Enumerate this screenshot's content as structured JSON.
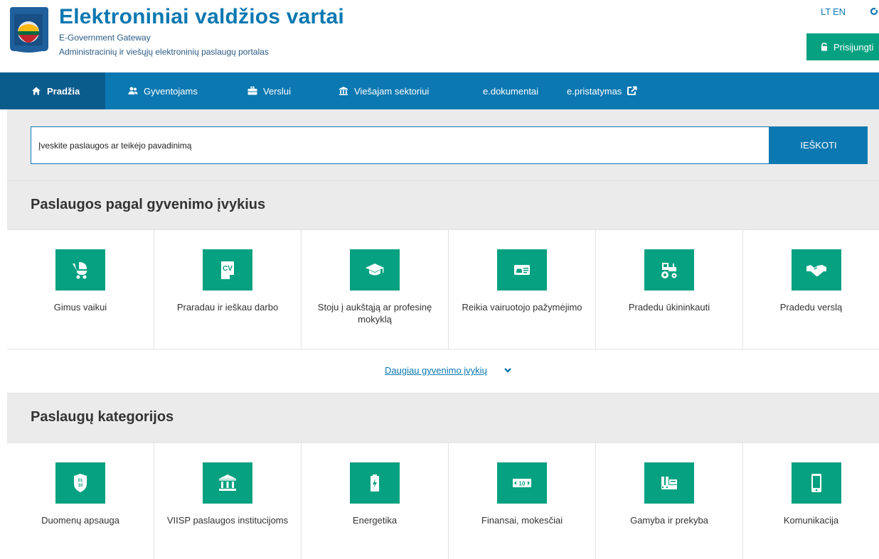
{
  "header": {
    "title": "Elektroniniai valdžios vartai",
    "subtitle": "E-Government Gateway",
    "tagline": "Administracinių ir viešųjų elektroninių paslaugų portalas",
    "lang_lt": "LT",
    "lang_en": "EN",
    "login_label": "Prisijungti"
  },
  "nav": {
    "items": [
      {
        "label": "Pradžia",
        "icon": "home-icon"
      },
      {
        "label": "Gyventojams",
        "icon": "users-icon"
      },
      {
        "label": "Verslui",
        "icon": "briefcase-icon"
      },
      {
        "label": "Viešajam sektoriui",
        "icon": "institution-icon"
      },
      {
        "label": "e.dokumentai",
        "icon": ""
      },
      {
        "label": "e.pristatymas",
        "icon": "external-link-icon"
      }
    ]
  },
  "search": {
    "placeholder": "Įveskite paslaugos ar teikėjo pavadinimą",
    "button_label": "IEŠKOTI"
  },
  "life_events": {
    "heading": "Paslaugos pagal gyvenimo įvykius",
    "items": [
      {
        "label": "Gimus vaikui",
        "icon": "stroller-icon"
      },
      {
        "label": "Praradau ir ieškau darbo",
        "icon": "cv-icon"
      },
      {
        "label": "Stoju į aukštąją ar profesinę mokyklą",
        "icon": "graduation-cap-icon"
      },
      {
        "label": "Reikia vairuotojo pažymėjimo",
        "icon": "driver-license-icon"
      },
      {
        "label": "Pradedu ūkininkauti",
        "icon": "tractor-icon"
      },
      {
        "label": "Pradedu verslą",
        "icon": "handshake-icon"
      }
    ],
    "more_label": "Daugiau gyvenimo įvykių"
  },
  "categories": {
    "heading": "Paslaugų kategorijos",
    "items": [
      {
        "label": "Duomenų apsauga",
        "icon": "shield-data-icon"
      },
      {
        "label": "VIISP paslaugos institucijoms",
        "icon": "institution-icon"
      },
      {
        "label": "Energetika",
        "icon": "battery-icon"
      },
      {
        "label": "Finansai, mokesčiai",
        "icon": "banknote-icon"
      },
      {
        "label": "Gamyba ir prekyba",
        "icon": "factory-icon"
      },
      {
        "label": "Komunikacija",
        "icon": "smartphone-icon"
      }
    ]
  },
  "colors": {
    "brand_blue": "#0b78b1",
    "nav_active": "#0a5c8c",
    "accent_green": "#06a180",
    "band_gray": "#ebebeb"
  }
}
